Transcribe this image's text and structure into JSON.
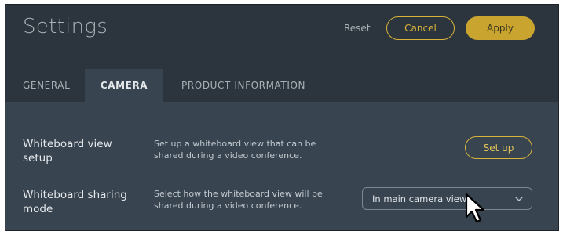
{
  "header": {
    "title": "Settings",
    "reset_label": "Reset",
    "cancel_label": "Cancel",
    "apply_label": "Apply"
  },
  "tabs": [
    {
      "label": "GENERAL",
      "active": false
    },
    {
      "label": "CAMERA",
      "active": true
    },
    {
      "label": "PRODUCT INFORMATION",
      "active": false
    }
  ],
  "settings": {
    "whiteboard_view": {
      "label": "Whiteboard view setup",
      "description": "Set up a whiteboard view that can be shared during a video conference.",
      "button_label": "Set up"
    },
    "whiteboard_sharing": {
      "label": "Whiteboard sharing mode",
      "description": "Select how the whiteboard view will be shared during a video conference.",
      "selected_value": "In main camera view"
    }
  },
  "icons": {
    "dropdown": "chevron-down-icon",
    "cursor": "mouse-pointer-icon"
  },
  "colors": {
    "header_bg": "#2c353d",
    "content_bg": "#384450",
    "accent": "#c9a52f"
  }
}
